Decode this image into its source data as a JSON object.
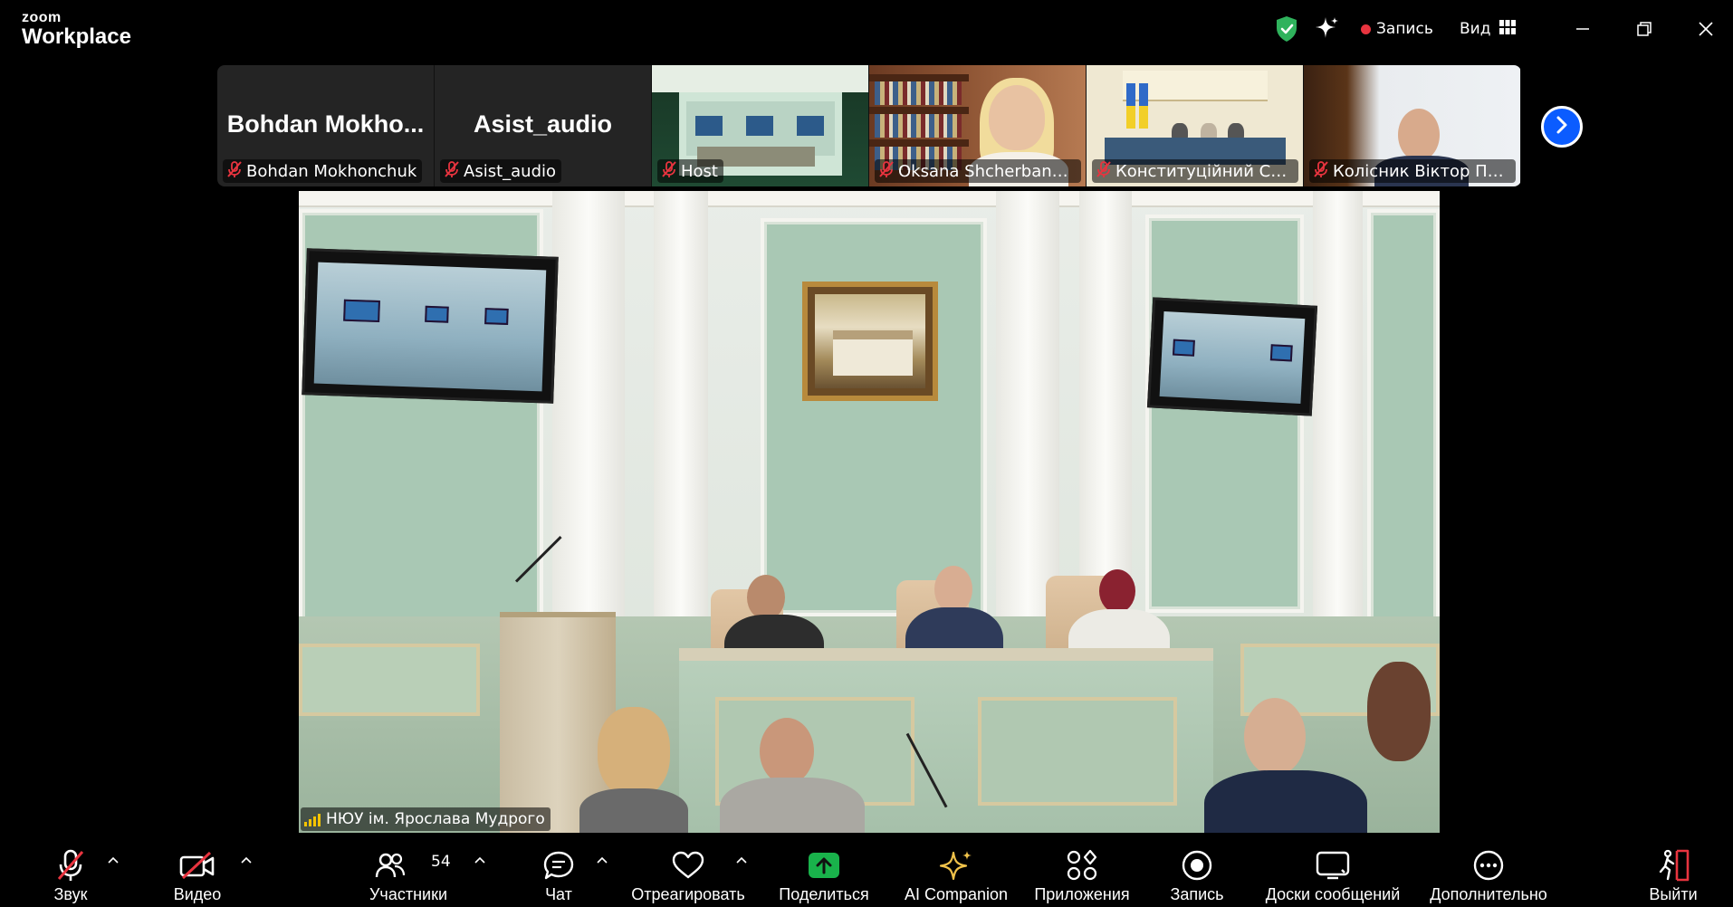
{
  "app": {
    "logo_line1": "zoom",
    "logo_line2": "Workplace"
  },
  "titlebar": {
    "record_label": "Запись",
    "view_label": "Вид"
  },
  "participants": [
    {
      "display": "Bohdan  Mokho...",
      "label": "Bohdan Mokhonchuk",
      "video": false
    },
    {
      "display": "Asist_audio",
      "label": "Asist_audio",
      "video": false
    },
    {
      "display": "",
      "label": "Host",
      "video": true
    },
    {
      "display": "",
      "label": "Oksana Shcherbanyuk",
      "video": true
    },
    {
      "display": "",
      "label": "Конституційний Суд У...",
      "video": true
    },
    {
      "display": "",
      "label": "Колісник Віктор Павл...",
      "video": true
    }
  ],
  "main_video": {
    "label": "НЮУ ім. Ярослава Мудрого"
  },
  "toolbar": {
    "audio": "Звук",
    "video": "Видео",
    "participants": "Участники",
    "participants_count": "54",
    "chat": "Чат",
    "react": "Отреагировать",
    "share": "Поделиться",
    "ai": "AI Companion",
    "apps": "Приложения",
    "record": "Запись",
    "boards": "Доски сообщений",
    "more": "Дополнительно",
    "leave": "Выйти"
  },
  "colors": {
    "accent_blue": "#0b5cff",
    "muted_red": "#e8343f",
    "shield_green": "#2fb25c",
    "share_green": "#19b24b",
    "signal_yellow": "#f5c400"
  }
}
